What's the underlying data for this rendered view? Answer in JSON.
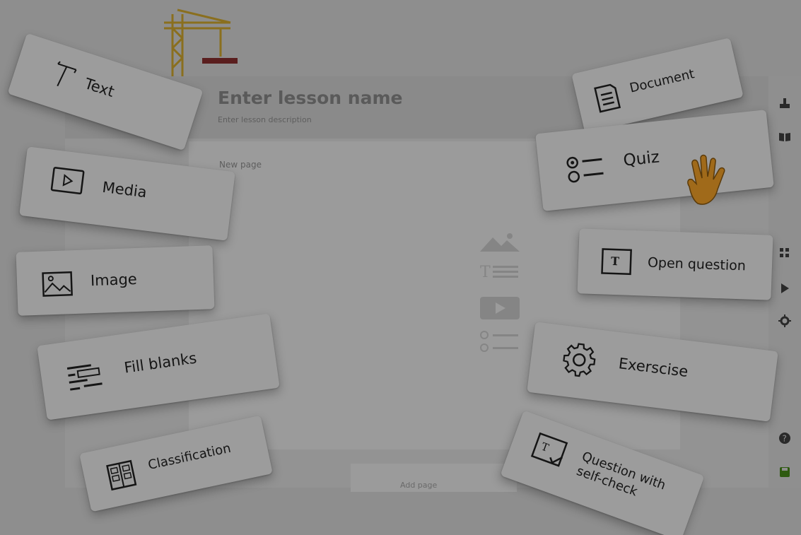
{
  "editor": {
    "lesson_title": "Enter lesson name",
    "lesson_description": "Enter lesson description",
    "page_label": "New page",
    "add_page_label": "Add page"
  },
  "cards": {
    "text": "Text",
    "media": "Media",
    "image": "Image",
    "fill_blanks": "Fill blanks",
    "classification": "Classification",
    "document": "Document",
    "quiz": "Quiz",
    "open_question": "Open question",
    "exercise": "Exerscise",
    "question_self_check_line1": "Question with",
    "question_self_check_line2": "self-check"
  },
  "right_toolbar": {
    "icons": [
      "upload-icon",
      "book-icon",
      "grid-icon",
      "play-icon",
      "gear-icon",
      "help-icon",
      "save-icon"
    ]
  },
  "decorations": [
    "crane-icon",
    "waving-hand-icon"
  ],
  "colors": {
    "overlay_background": "#8e8e8e",
    "card_background": "#9c9c9c",
    "text_dark": "#151515",
    "crane_yellow": "#8a6f1e",
    "hand_orange": "#a06a1a",
    "save_green": "#2e5a10"
  }
}
